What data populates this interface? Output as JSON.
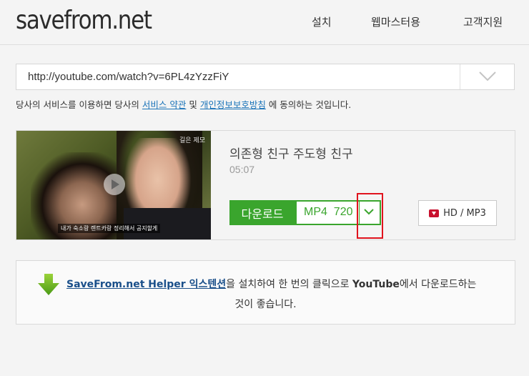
{
  "header": {
    "logo": "savefrom.net",
    "nav": [
      "설치",
      "웹마스터용",
      "고객지원"
    ]
  },
  "search": {
    "url_value": "http://youtube.com/watch?v=6PL4zYzzFiY",
    "dropdown_icon": "chevron-down-icon"
  },
  "terms": {
    "prefix": "당사의 서비스를 이용하면 당사의 ",
    "link1": "서비스 약관",
    "mid": " 및 ",
    "link2": "개인정보보호방침",
    "suffix": " 에 동의하는 것입니다."
  },
  "result": {
    "thumbnail": {
      "caption": "내가 숙소랑 렌트카랑 정리해서 공지할게",
      "watermark": "길은 제모"
    },
    "title": "의존형 친구 주도형 친구",
    "duration": "05:07",
    "download_label": "다운로드",
    "format_label": "MP4  720",
    "hd_label": "HD / MP3"
  },
  "promo": {
    "link": "SaveFrom.net Helper 익스텐션",
    "text1": "을 설치하여 한 번의 클릭으로 ",
    "bold": "YouTube",
    "text2": "에서 다운로드하는",
    "line2": "것이 좋습니다."
  },
  "colors": {
    "accent_green": "#3aa52d",
    "link_blue": "#1a73b8",
    "highlight_red": "#e0131d",
    "hd_red": "#c8102e"
  }
}
